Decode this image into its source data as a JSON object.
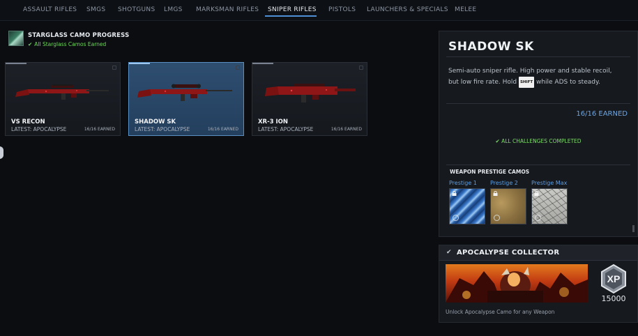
{
  "nav": {
    "tabs": [
      {
        "label": "ASSAULT RIFLES"
      },
      {
        "label": "SMGS"
      },
      {
        "label": "SHOTGUNS"
      },
      {
        "label": "LMGS"
      },
      {
        "label": "MARKSMAN RIFLES"
      },
      {
        "label": "SNIPER RIFLES"
      },
      {
        "label": "PISTOLS"
      },
      {
        "label": "LAUNCHERS & SPECIALS"
      },
      {
        "label": "MELEE"
      }
    ],
    "active": "SNIPER RIFLES"
  },
  "camo_progress": {
    "title": "STARGLASS CAMO PROGRESS",
    "status": "All Starglass Camos Earned"
  },
  "weapons": [
    {
      "name": "VS RECON",
      "latest": "LATEST: APOCALYPSE",
      "earned": "16/16 EARNED"
    },
    {
      "name": "SHADOW SK",
      "latest": "LATEST: APOCALYPSE",
      "earned": "16/16 EARNED"
    },
    {
      "name": "XR-3 ION",
      "latest": "LATEST: APOCALYPSE",
      "earned": "16/16 EARNED"
    }
  ],
  "selected_weapon": {
    "title": "SHADOW SK",
    "desc_pre": "Semi-auto sniper rifle. High power and stable recoil, but low fire rate. Hold ",
    "key": "SHIFT",
    "desc_post": " while ADS to steady.",
    "earned": "16/16 EARNED",
    "challenges": "ALL CHALLENGES COMPLETED"
  },
  "prestige": {
    "title": "WEAPON PRESTIGE CAMOS",
    "items": [
      {
        "label": "Prestige 1"
      },
      {
        "label": "Prestige 2"
      },
      {
        "label": "Prestige Max"
      }
    ]
  },
  "event": {
    "title": "APOCALYPSE COLLECTOR",
    "xp_label": "XP",
    "xp_amount": "15000",
    "description": "Unlock Apocalypse Camo for any Weapon"
  },
  "colors": {
    "accent_blue": "#4f8fd6",
    "success_green": "#6fd85a",
    "camo_red": "#8e1616"
  }
}
